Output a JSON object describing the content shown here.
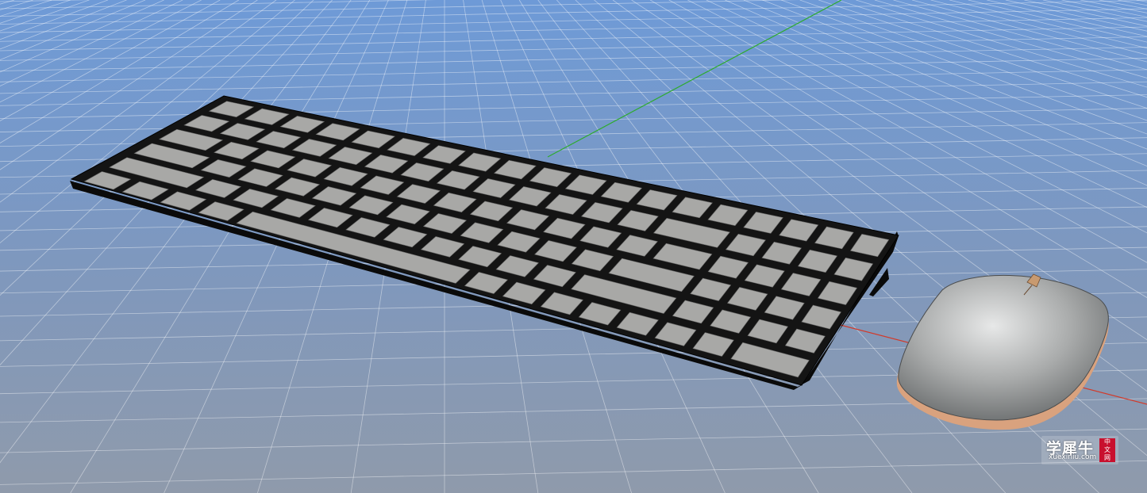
{
  "scene": {
    "background_top": "#6f9bd6",
    "background_bottom": "#8e99ad",
    "grid_color": "#ffffff",
    "axis_green": "#2eab2e",
    "axis_red": "#d23a2a",
    "key_color": "#a8a8a6",
    "keyboard_frame": "#111111",
    "mouse_color": "#a9abab",
    "mouse_trim": "#c79070"
  },
  "watermark": {
    "brand_cn": "学犀牛",
    "site": "xuexiniu.com",
    "badge_chars": [
      "中",
      "文",
      "网"
    ]
  }
}
